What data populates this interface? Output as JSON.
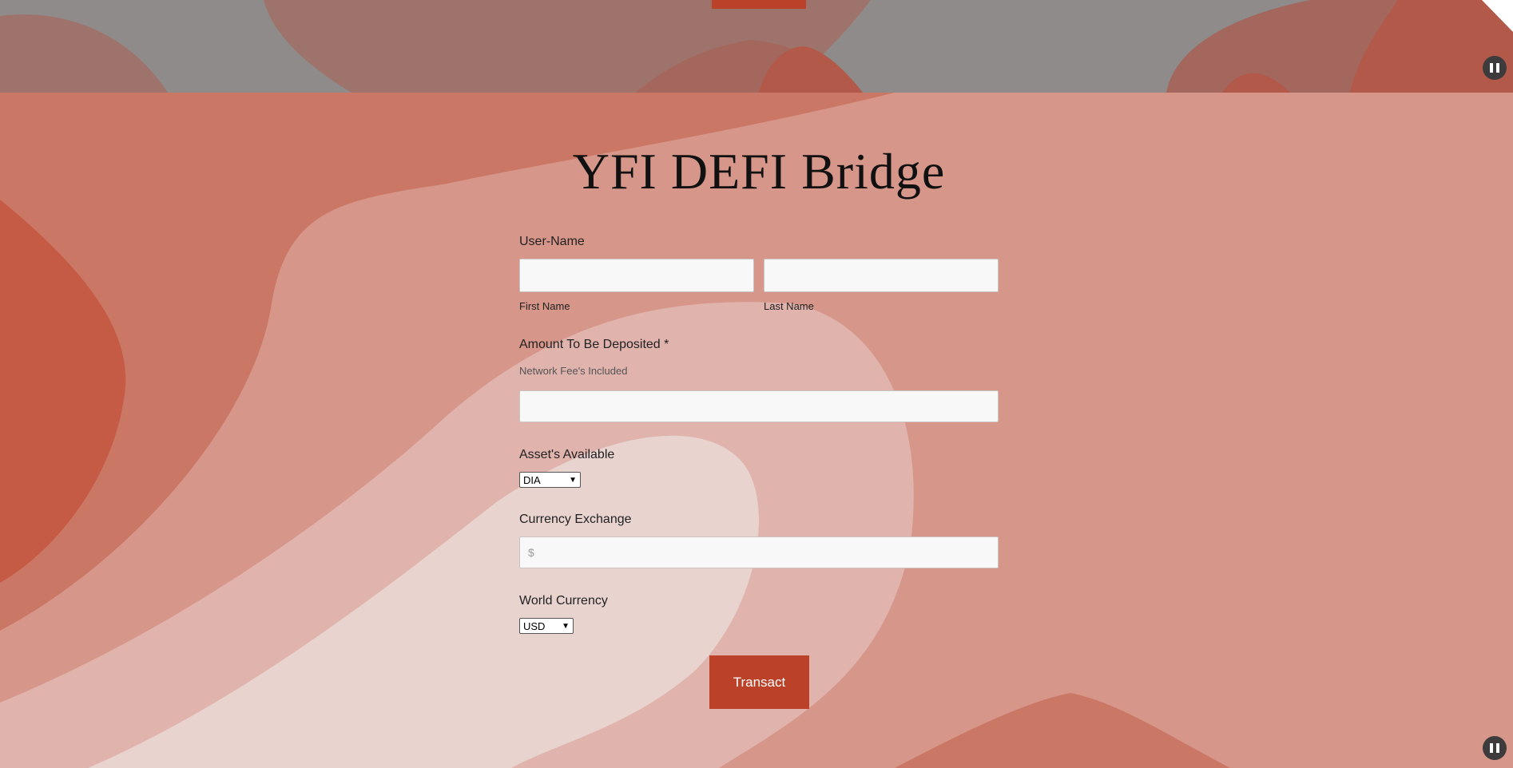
{
  "page": {
    "title": "YFI DEFI Bridge"
  },
  "form": {
    "username": {
      "label": "User-Name",
      "first_name": {
        "value": "",
        "sublabel": "First Name"
      },
      "last_name": {
        "value": "",
        "sublabel": "Last Name"
      }
    },
    "amount": {
      "label": "Amount To Be Deposited *",
      "hint": "Network Fee's Included",
      "value": ""
    },
    "assets": {
      "label": "Asset's Available",
      "selected": "DIA"
    },
    "currency_exchange": {
      "label": "Currency Exchange",
      "placeholder": "$",
      "value": ""
    },
    "world_currency": {
      "label": "World Currency",
      "selected": "USD"
    },
    "submit_label": "Transact"
  },
  "controls": {
    "pause_icon": "pause-icon"
  },
  "colors": {
    "accent": "#bc4129",
    "background": "#d69689",
    "header_gray": "#8f8b8a"
  }
}
